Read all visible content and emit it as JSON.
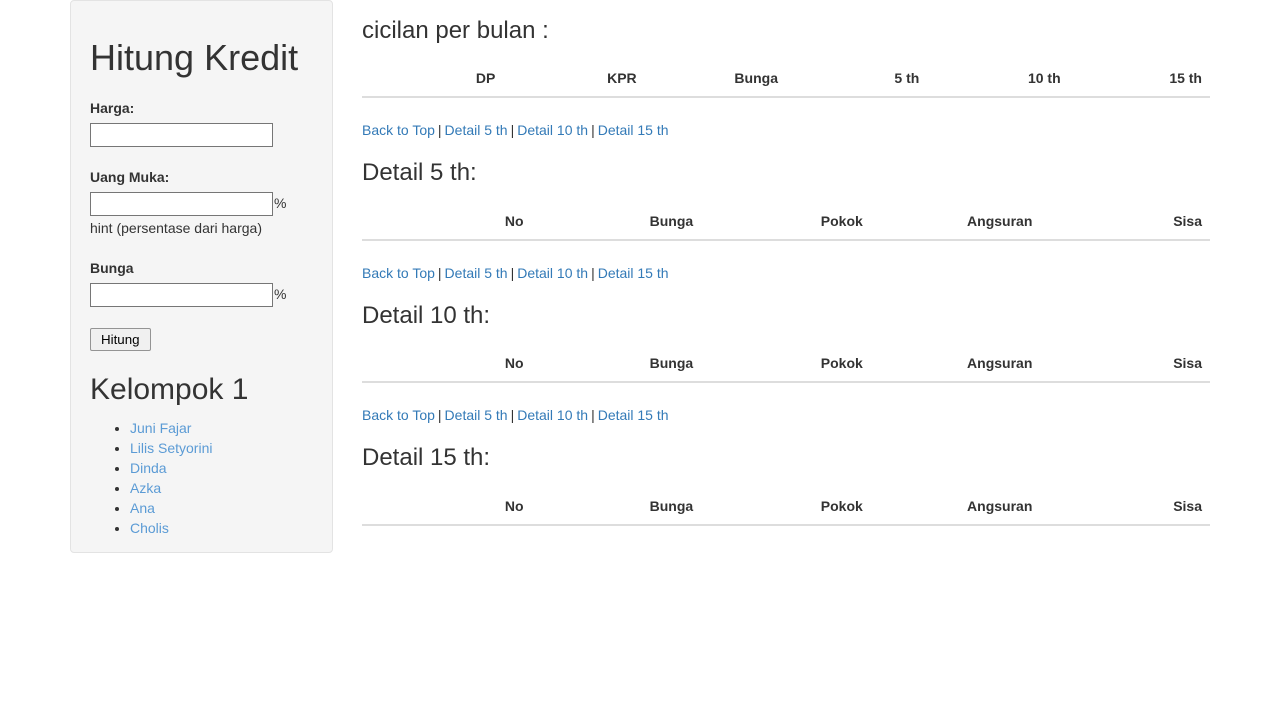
{
  "sidebar": {
    "title": "Hitung Kredit",
    "fields": [
      {
        "label": "Harga:",
        "value": "",
        "placeholder": "",
        "suffix": "",
        "hint": ""
      },
      {
        "label": "Uang Muka:",
        "value": "",
        "placeholder": "",
        "suffix": "%",
        "hint": "hint (persentase dari harga)"
      },
      {
        "label": "Bunga",
        "value": "",
        "placeholder": "",
        "suffix": "%",
        "hint": ""
      }
    ],
    "submit_label": "Hitung",
    "group_title": "Kelompok 1",
    "members": [
      "Juni Fajar",
      "Lilis Setyorini",
      "Dinda",
      "Azka",
      "Ana",
      "Cholis"
    ]
  },
  "main": {
    "heading": "cicilan per bulan :",
    "summary_table": {
      "headers": [
        "DP",
        "KPR",
        "Bunga",
        "5 th",
        "10 th",
        "15 th"
      ],
      "rows": []
    },
    "nav": {
      "back_to_top": "Back to Top",
      "detail_5": "Detail 5 th",
      "detail_10": "Detail 10 th",
      "detail_15": "Detail 15 th",
      "separator": "|"
    },
    "sections": [
      {
        "heading": "Detail 5 th:",
        "headers": [
          "No",
          "Bunga",
          "Pokok",
          "Angsuran",
          "Sisa"
        ],
        "rows": []
      },
      {
        "heading": "Detail 10 th:",
        "headers": [
          "No",
          "Bunga",
          "Pokok",
          "Angsuran",
          "Sisa"
        ],
        "rows": []
      },
      {
        "heading": "Detail 15 th:",
        "headers": [
          "No",
          "Bunga",
          "Pokok",
          "Angsuran",
          "Sisa"
        ],
        "rows": []
      }
    ]
  },
  "colors": {
    "link": "#337ab7",
    "member_link": "#5b9bd5",
    "panel_bg": "#f5f5f5",
    "panel_border": "#e3e3e3",
    "text": "#333333"
  }
}
